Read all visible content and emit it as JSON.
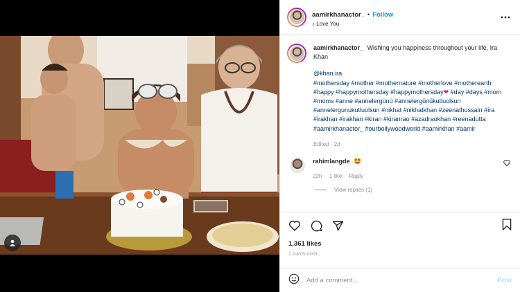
{
  "header": {
    "username": "aamirkhanactor_",
    "separator": "•",
    "follow_label": "Follow",
    "audio": "Love You",
    "audio_prefix": "♪",
    "more_icon": "more-horizontal-icon"
  },
  "caption": {
    "username": "aamirkhanactor_",
    "text": "Wishing you happiness throughout your life, Ira Khan",
    "mention": "@khan.ira",
    "tags_before_heart": "#mothersday #mother #mothernature #motherlove #motherearth #happy #happymothersday #happymothersday",
    "tags_after_heart": " #day #days #mom #moms #anne #annelergünü #annelergünükutluolsun #annelergunukutluolsun #nikhat #nikhatkhan #zeenathussain #ira #irakhan #irakhan #kiran #kiranrao #azadraokhan #reenadutta #aamirkhanactor_ #ourbollywoodworld #aamirkhan #aamir",
    "heart": "❤",
    "meta": "Edited · 2d"
  },
  "comment": {
    "username": "rahimlangde",
    "text": "🤩",
    "time": "22h",
    "likes": "1 like",
    "reply": "Reply",
    "view_replies": "View replies (1)"
  },
  "actions": {
    "likes": "1,361 likes",
    "date": "2 DAYS AGO"
  },
  "add_comment": {
    "placeholder": "Add a comment...",
    "post_label": "Post"
  },
  "colors": {
    "link": "#00376b",
    "follow": "#0095f6",
    "post_disabled": "#b2dffc",
    "muted": "#8e8e8e"
  }
}
